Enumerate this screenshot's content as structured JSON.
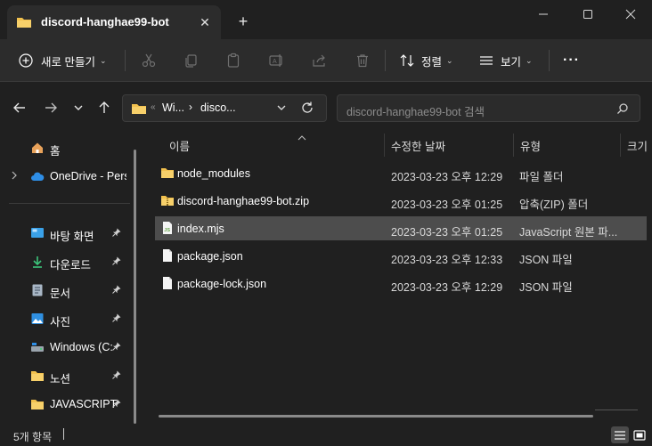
{
  "window": {
    "tab_title": "discord-hanghae99-bot",
    "tab_close": "✕",
    "new_tab": "+"
  },
  "toolbar": {
    "new_label": "새로 만들기",
    "sort_label": "정렬",
    "view_label": "보기",
    "more_label": "···"
  },
  "address": {
    "overflow": "«",
    "crumb1": "Wi...",
    "crumb_sep": "›",
    "crumb2": "disco...",
    "search_placeholder": "discord-hanghae99-bot 검색"
  },
  "sidebar": {
    "items": [
      {
        "label": "홈",
        "icon": "home-icon"
      },
      {
        "label": "OneDrive - Pers",
        "icon": "cloud-icon"
      },
      {
        "label": "바탕 화면",
        "icon": "desktop-icon"
      },
      {
        "label": "다운로드",
        "icon": "download-icon"
      },
      {
        "label": "문서",
        "icon": "document-icon"
      },
      {
        "label": "사진",
        "icon": "picture-icon"
      },
      {
        "label": "Windows (C:",
        "icon": "drive-icon"
      },
      {
        "label": "노션",
        "icon": "folder-icon"
      },
      {
        "label": "JAVASCRIPT",
        "icon": "folder-icon"
      }
    ]
  },
  "columns": {
    "name": "이름",
    "date": "수정한 날짜",
    "type": "유형",
    "size": "크기"
  },
  "files": [
    {
      "name": "node_modules",
      "date": "2023-03-23 오후 12:29",
      "type": "파일 폴더",
      "icon": "folder-icon"
    },
    {
      "name": "discord-hanghae99-bot.zip",
      "date": "2023-03-23 오후 01:25",
      "type": "압축(ZIP) 폴더",
      "icon": "zip-folder-icon"
    },
    {
      "name": "index.mjs",
      "date": "2023-03-23 오후 01:25",
      "type": "JavaScript 원본 파...",
      "icon": "js-file-icon"
    },
    {
      "name": "package.json",
      "date": "2023-03-23 오후 12:33",
      "type": "JSON 파일",
      "icon": "file-icon"
    },
    {
      "name": "package-lock.json",
      "date": "2023-03-23 오후 12:29",
      "type": "JSON 파일",
      "icon": "file-icon"
    }
  ],
  "status": {
    "count": "5개 항목"
  },
  "colors": {
    "background": "#202020",
    "toolbar": "#2c2c2c",
    "selection": "#4d4d4d",
    "folder": "#f2c14e"
  }
}
